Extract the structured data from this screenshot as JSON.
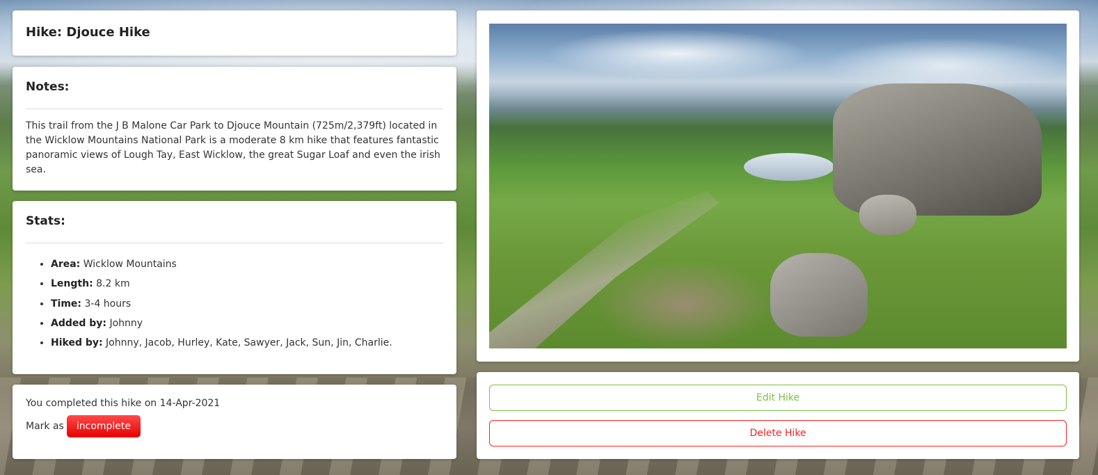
{
  "hike": {
    "title": "Hike: Djouce Hike"
  },
  "notes": {
    "heading": "Notes:",
    "text": "This trail from the J B Malone Car Park to Djouce Mountain (725m/2,379ft) located in the Wicklow Mountains National Park is a moderate 8 km hike that features fantastic panoramic views of Lough Tay, East Wicklow, the great Sugar Loaf and even the irish sea."
  },
  "stats": {
    "heading": "Stats:",
    "items": [
      {
        "label": "Area:",
        "value": " Wicklow Mountains"
      },
      {
        "label": "Length:",
        "value": " 8.2 km"
      },
      {
        "label": "Time:",
        "value": " 3-4 hours"
      },
      {
        "label": "Added by:",
        "value": " Johnny"
      },
      {
        "label": "Hiked by:",
        "value": " Johnny, Jacob, Hurley, Kate, Sawyer, Jack, Sun, Jin, Charlie."
      }
    ]
  },
  "completion": {
    "message": "You completed this hike on 14-Apr-2021",
    "mark_prefix": "Mark as",
    "incomplete_button": "incomplete"
  },
  "photo": {
    "alt": "Djouce Hike"
  },
  "actions": {
    "edit_label": "Edit Hike",
    "delete_label": "Delete Hike"
  },
  "colors": {
    "edit": "#7ac142",
    "delete": "#ff1f1f",
    "incomplete": "#ff2626"
  }
}
